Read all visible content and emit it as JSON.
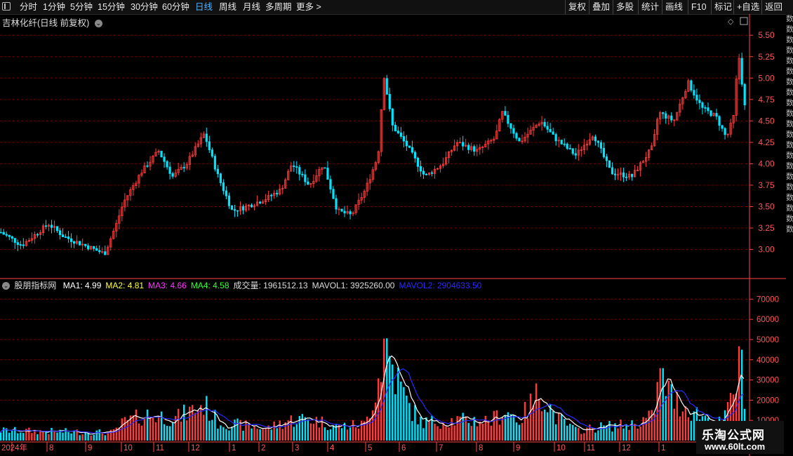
{
  "toolbar": {
    "periods": [
      {
        "label": "分时",
        "active": false
      },
      {
        "label": "1分钟",
        "active": false
      },
      {
        "label": "5分钟",
        "active": false
      },
      {
        "label": "15分钟",
        "active": false
      },
      {
        "label": "30分钟",
        "active": false
      },
      {
        "label": "60分钟",
        "active": false
      },
      {
        "label": "日线",
        "active": true
      },
      {
        "label": "周线",
        "active": false
      },
      {
        "label": "月线",
        "active": false
      },
      {
        "label": "多周期",
        "active": false
      },
      {
        "label": "更多 >",
        "active": false
      }
    ],
    "right": [
      "复权",
      "叠加",
      "多股",
      "统计",
      "画线",
      "F10",
      "标记",
      "+自选",
      "返回"
    ]
  },
  "stock": {
    "title": "吉林化纤(日线 前复权)"
  },
  "price_axis": [
    "5.50",
    "5.25",
    "5.00",
    "4.75",
    "4.50",
    "4.25",
    "4.00",
    "3.75",
    "3.50",
    "3.25",
    "3.00"
  ],
  "indicator": {
    "name": "股朋指标网",
    "items": [
      {
        "text": "MA1: 4.99",
        "color": "#ffffff"
      },
      {
        "text": "MA2: 4.81",
        "color": "#ffff33"
      },
      {
        "text": "MA3: 4.66",
        "color": "#ff33ff"
      },
      {
        "text": "MA4: 4.58",
        "color": "#33ff33"
      },
      {
        "text": "成交量: 1961512.13",
        "color": "#dddddd"
      },
      {
        "text": "MAVOL1: 3925260.00",
        "color": "#dddddd"
      },
      {
        "text": "MAVOL2: 2904633.50",
        "color": "#2a2aff"
      }
    ]
  },
  "volume_axis": [
    "70000",
    "60000",
    "50000",
    "40000",
    "30000",
    "20000",
    "10000"
  ],
  "date_axis": [
    "2024年",
    "8",
    "9",
    "10",
    "11",
    "12",
    "1",
    "2",
    "3",
    "4",
    "5",
    "6",
    "7",
    "8",
    "9",
    "10",
    "11",
    "12",
    "1"
  ],
  "right_strip": [
    "数",
    "数",
    "数",
    "数",
    "数",
    "数",
    "数",
    "数",
    "数",
    "数",
    "数",
    "数",
    "数",
    "数",
    "数",
    "数",
    "数",
    "数",
    "数",
    "数",
    "数"
  ],
  "watermark": {
    "title": "乐淘公式网",
    "url": "www.60lt.com"
  },
  "colors": {
    "up": "#ff3b3b",
    "down": "#00e5ff",
    "grid": "#6b0000",
    "axis": "#ff4444",
    "ma1": "#ffffff",
    "mavol2": "#2a2aff"
  },
  "chart_data": {
    "type": "candlestick",
    "title": "吉林化纤(日线 前复权)",
    "price_ylim": [
      2.8,
      5.6
    ],
    "volume_ylim": [
      0,
      75000
    ],
    "price_keypoints": [
      [
        0,
        3.2
      ],
      [
        30,
        3.05
      ],
      [
        68,
        3.3
      ],
      [
        90,
        3.15
      ],
      [
        148,
        2.95
      ],
      [
        165,
        3.3
      ],
      [
        175,
        3.55
      ],
      [
        200,
        3.9
      ],
      [
        225,
        4.15
      ],
      [
        245,
        3.85
      ],
      [
        265,
        4.0
      ],
      [
        290,
        4.35
      ],
      [
        310,
        3.85
      ],
      [
        330,
        3.45
      ],
      [
        350,
        3.5
      ],
      [
        380,
        3.6
      ],
      [
        400,
        3.7
      ],
      [
        415,
        4.0
      ],
      [
        440,
        3.75
      ],
      [
        460,
        4.0
      ],
      [
        480,
        3.45
      ],
      [
        500,
        3.4
      ],
      [
        520,
        3.7
      ],
      [
        538,
        4.1
      ],
      [
        546,
        5.05
      ],
      [
        558,
        4.45
      ],
      [
        580,
        4.2
      ],
      [
        605,
        3.85
      ],
      [
        630,
        4.0
      ],
      [
        650,
        4.25
      ],
      [
        680,
        4.15
      ],
      [
        705,
        4.3
      ],
      [
        715,
        4.6
      ],
      [
        740,
        4.25
      ],
      [
        770,
        4.5
      ],
      [
        790,
        4.3
      ],
      [
        820,
        4.1
      ],
      [
        845,
        4.35
      ],
      [
        870,
        3.9
      ],
      [
        900,
        3.85
      ],
      [
        930,
        4.2
      ],
      [
        938,
        4.6
      ],
      [
        960,
        4.5
      ],
      [
        980,
        4.95
      ],
      [
        1000,
        4.65
      ],
      [
        1020,
        4.55
      ],
      [
        1035,
        4.3
      ],
      [
        1045,
        4.55
      ],
      [
        1052,
        5.3
      ],
      [
        1062,
        4.6
      ]
    ],
    "volume_keypoints": [
      [
        0,
        5000
      ],
      [
        160,
        4000
      ],
      [
        175,
        9000
      ],
      [
        210,
        13000
      ],
      [
        250,
        11000
      ],
      [
        290,
        18000
      ],
      [
        310,
        9000
      ],
      [
        380,
        6000
      ],
      [
        410,
        10000
      ],
      [
        440,
        11000
      ],
      [
        480,
        7000
      ],
      [
        520,
        8000
      ],
      [
        538,
        30000
      ],
      [
        548,
        50000
      ],
      [
        560,
        35000
      ],
      [
        580,
        18000
      ],
      [
        600,
        9000
      ],
      [
        640,
        10000
      ],
      [
        700,
        10000
      ],
      [
        720,
        15000
      ],
      [
        740,
        10000
      ],
      [
        770,
        25000
      ],
      [
        790,
        12000
      ],
      [
        820,
        5000
      ],
      [
        860,
        7000
      ],
      [
        900,
        8000
      ],
      [
        930,
        12000
      ],
      [
        940,
        32000
      ],
      [
        960,
        20000
      ],
      [
        990,
        14000
      ],
      [
        1030,
        8000
      ],
      [
        1048,
        28000
      ],
      [
        1058,
        42000
      ],
      [
        1062,
        20000
      ]
    ],
    "x_range": [
      0,
      1065
    ]
  }
}
